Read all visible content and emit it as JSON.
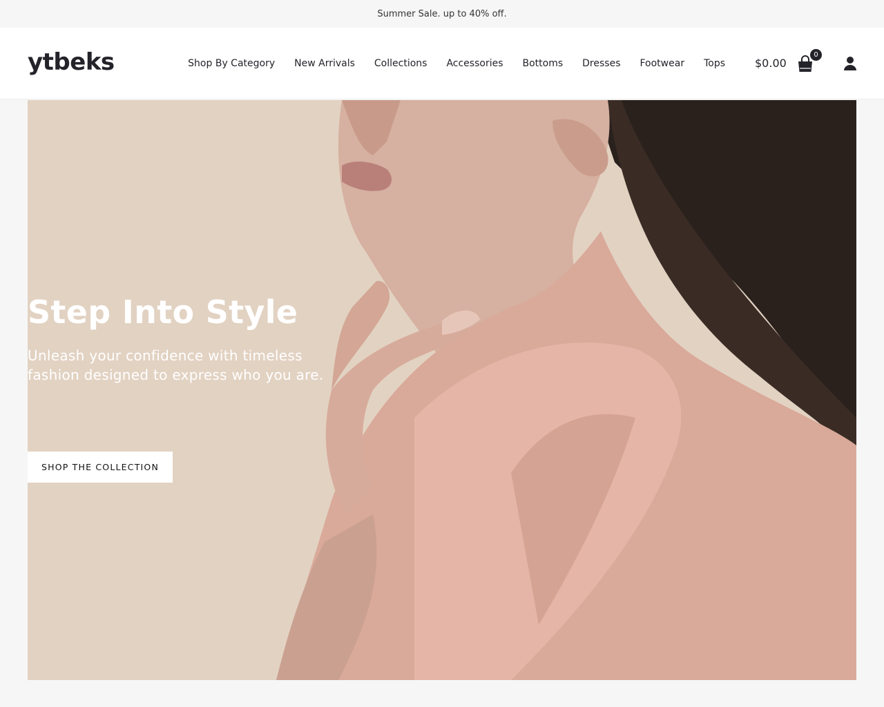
{
  "announcement": {
    "text": "Summer Sale. up to 40% off."
  },
  "header": {
    "logo": "ytbeks",
    "nav": [
      {
        "label": "Shop By Category"
      },
      {
        "label": "New Arrivals"
      },
      {
        "label": "Collections"
      },
      {
        "label": "Accessories"
      },
      {
        "label": "Bottoms"
      },
      {
        "label": "Dresses"
      },
      {
        "label": "Footwear"
      },
      {
        "label": "Tops"
      }
    ],
    "cart_total": "$0.00",
    "cart_count": "0",
    "icons": {
      "cart": "shopping-bag-icon",
      "account": "user-icon"
    }
  },
  "hero": {
    "title": "Step Into Style",
    "subtitle": "Unleash your confidence with timeless fashion designed to express who you are.",
    "button_label": "SHOP THE COLLECTION"
  },
  "colors": {
    "page_background": "#f6f6f6",
    "header_background": "#ffffff",
    "text_dark": "#24232a",
    "hero_background": "#e2d2c2",
    "garment": "#d9a99a",
    "hair": "#2a211d"
  }
}
